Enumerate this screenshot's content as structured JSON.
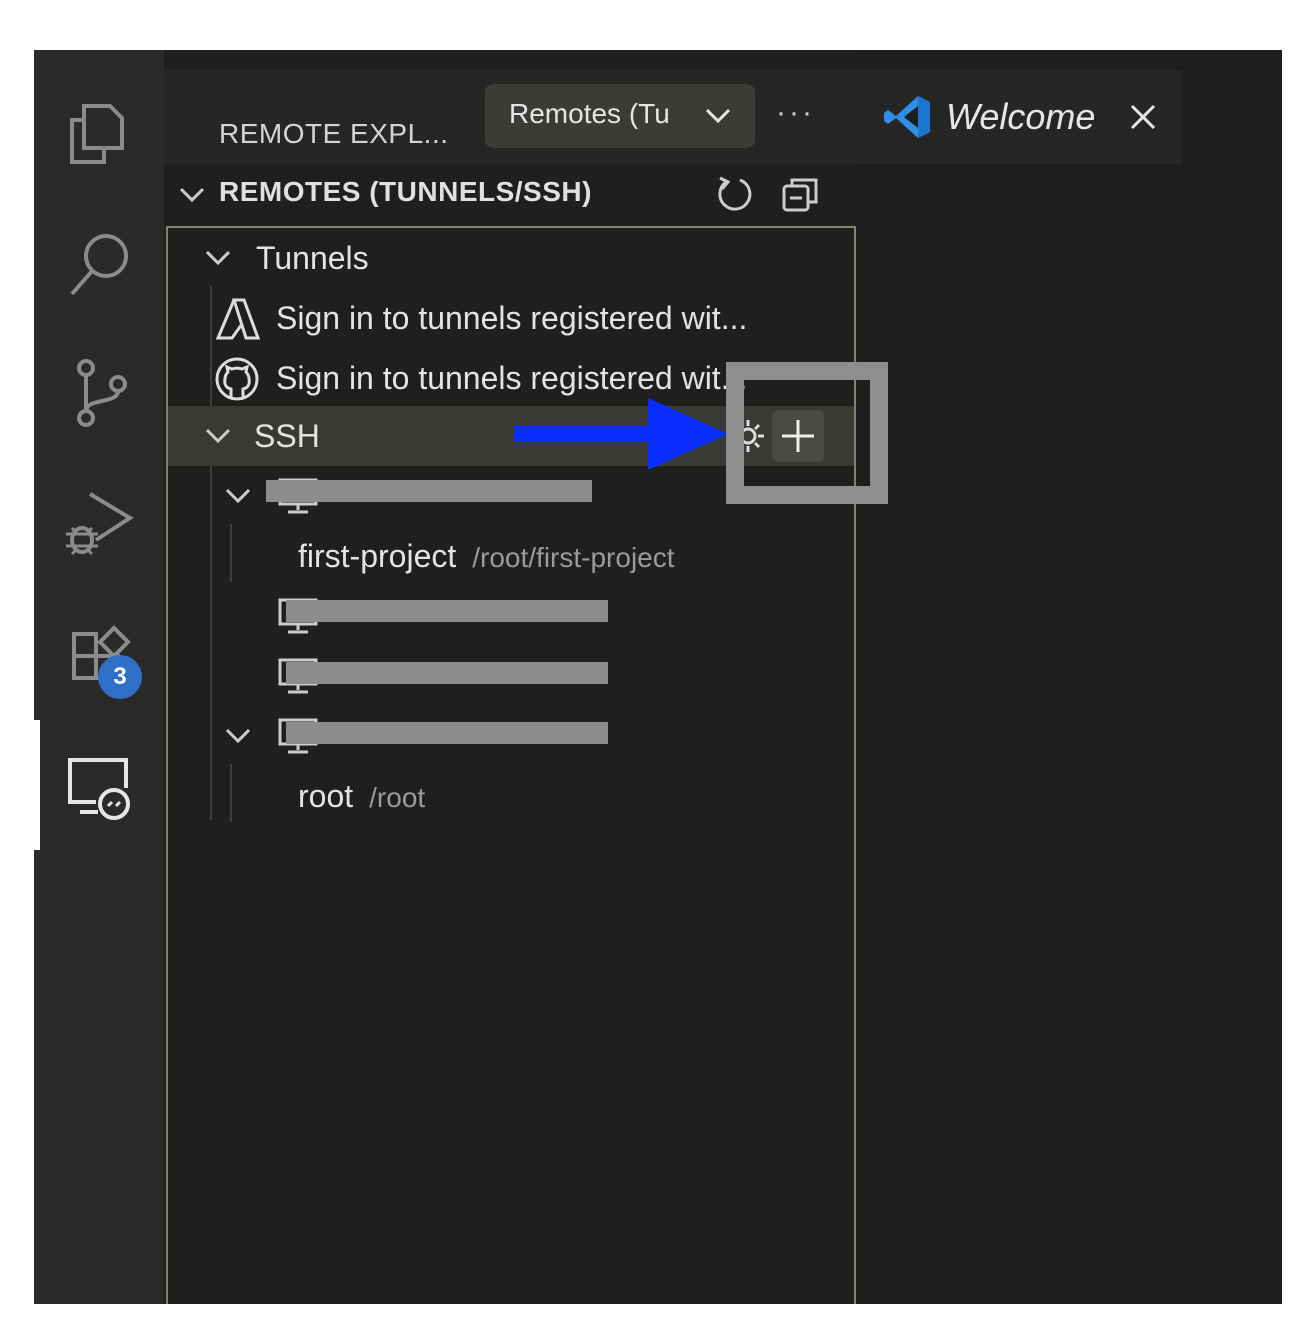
{
  "sidebar": {
    "title": "REMOTE EXPL...",
    "view_select": "Remotes (Tu",
    "more": "···",
    "section_title": "REMOTES (TUNNELS/SSH)"
  },
  "activity_bar": {
    "items": [
      "explorer-icon",
      "search-icon",
      "source-control-icon",
      "run-debug-icon",
      "extensions-icon",
      "remote-explorer-icon"
    ],
    "extensions_badge": "3"
  },
  "tree": {
    "tunnels": {
      "label": "Tunnels",
      "items": [
        {
          "icon": "azure-icon",
          "label": "Sign in to tunnels registered wit..."
        },
        {
          "icon": "github-icon",
          "label": "Sign in to tunnels registered wit..."
        }
      ]
    },
    "ssh": {
      "label": "SSH",
      "hosts": [
        {
          "expanded": true,
          "children": [
            {
              "name": "first-project",
              "path": "/root/first-project"
            }
          ]
        },
        {
          "expanded": false,
          "children": []
        },
        {
          "expanded": false,
          "children": []
        },
        {
          "expanded": true,
          "children": [
            {
              "name": "root",
              "path": "/root"
            }
          ]
        }
      ]
    }
  },
  "editor": {
    "tab_label": "Welcome"
  },
  "colors": {
    "annotation_arrow": "#0a2dff",
    "badge": "#2f6fc7"
  }
}
